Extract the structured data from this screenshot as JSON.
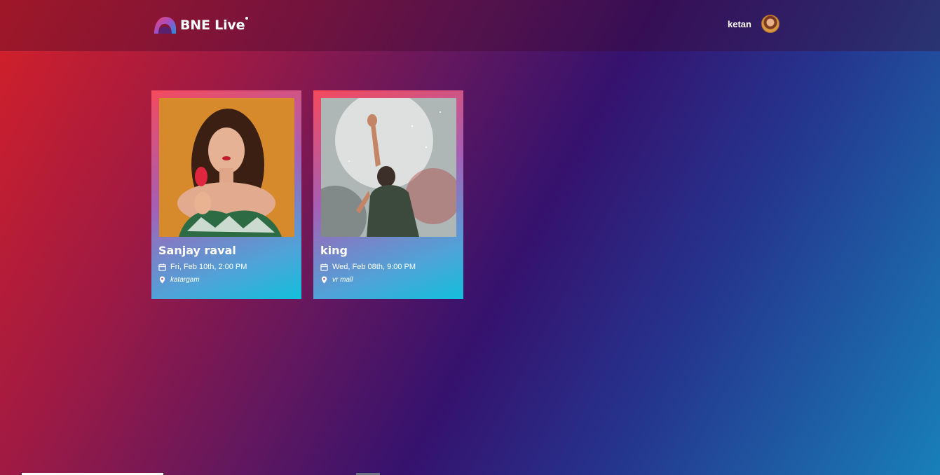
{
  "header": {
    "brand": "BNE Live",
    "user_name": "ketan"
  },
  "events": [
    {
      "title": "Sanjay raval",
      "date": "Fri, Feb 10th, 2:00 PM",
      "location": "katargam"
    },
    {
      "title": "king",
      "date": "Wed, Feb 08th, 9:00 PM",
      "location": "vr mall"
    }
  ],
  "icons": {
    "logo": "bne-live-logo-icon",
    "avatar": "user-avatar",
    "date": "calendar-icon",
    "location": "map-pin-icon"
  },
  "colors": {
    "background_start": "#d42028",
    "background_mid": "#35126e",
    "background_end": "#1880b8",
    "card_top": "#f44a5d",
    "card_bottom": "#12bfdc"
  }
}
